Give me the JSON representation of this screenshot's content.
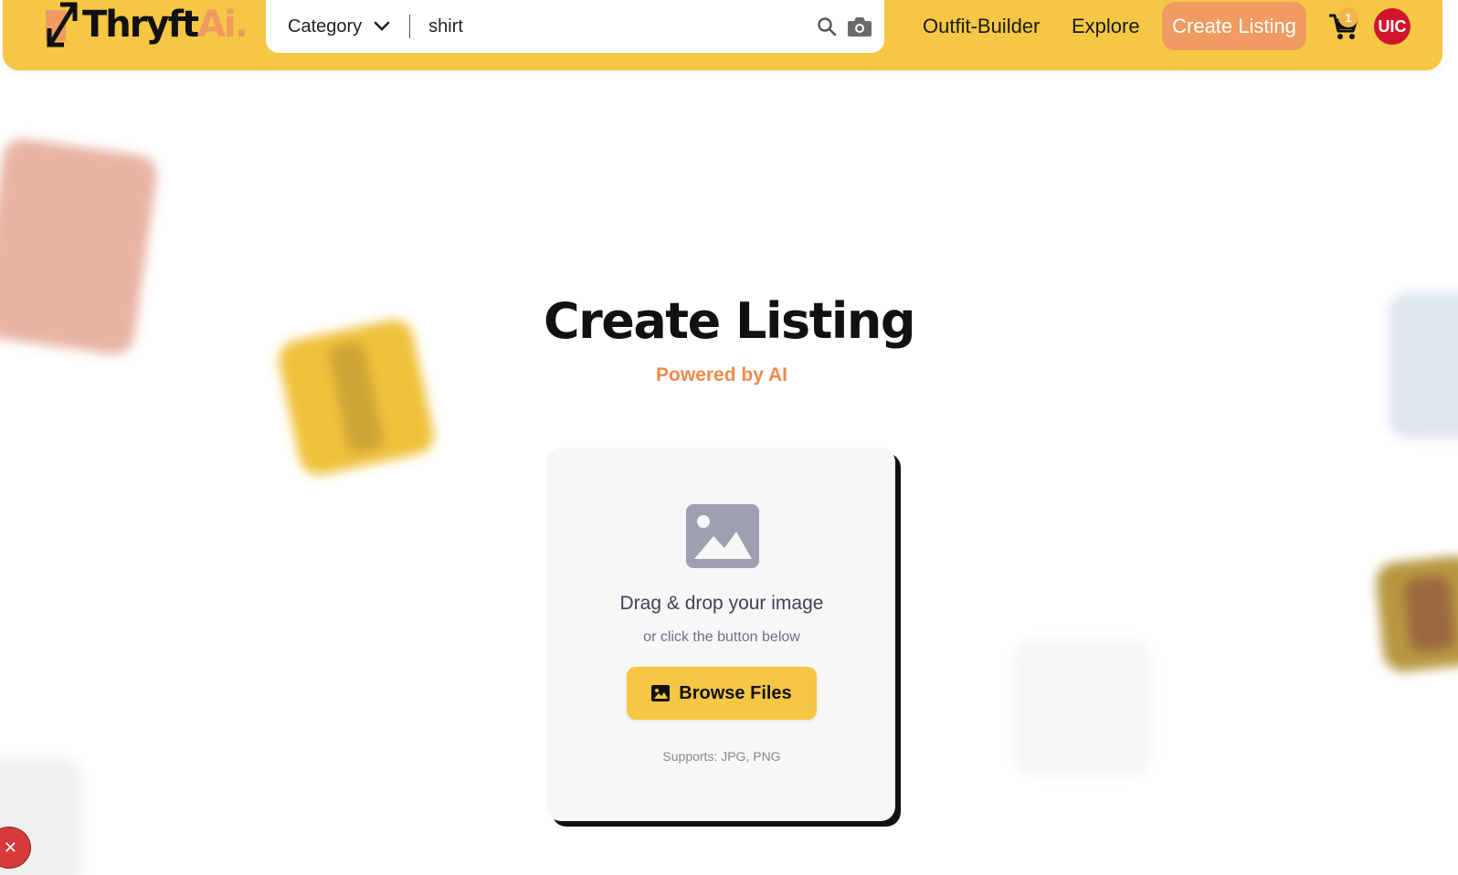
{
  "header": {
    "logo": {
      "part1": "Thryft",
      "part2": "Ai."
    },
    "search": {
      "category_label": "Category",
      "query": "shirt"
    },
    "nav": {
      "outfit_builder": "Outfit-Builder",
      "explore": "Explore",
      "create_listing": "Create Listing"
    },
    "cart_count": "1",
    "avatar_initials": "UIC"
  },
  "main": {
    "title": "Create Listing",
    "subtitle": "Powered by AI",
    "upload": {
      "heading": "Drag & drop your image",
      "subheading": "or click the button below",
      "browse_label": "Browse Files",
      "supports": "Supports: JPG, PNG"
    }
  },
  "colors": {
    "brand_yellow": "#f6c744",
    "accent_orange": "#ef9b61",
    "avatar_red": "#d2152f"
  },
  "icons": [
    "logo-mark-icon",
    "chevron-down-icon",
    "search-icon",
    "camera-icon",
    "cart-icon",
    "image-placeholder-icon",
    "image-icon",
    "close-icon"
  ]
}
